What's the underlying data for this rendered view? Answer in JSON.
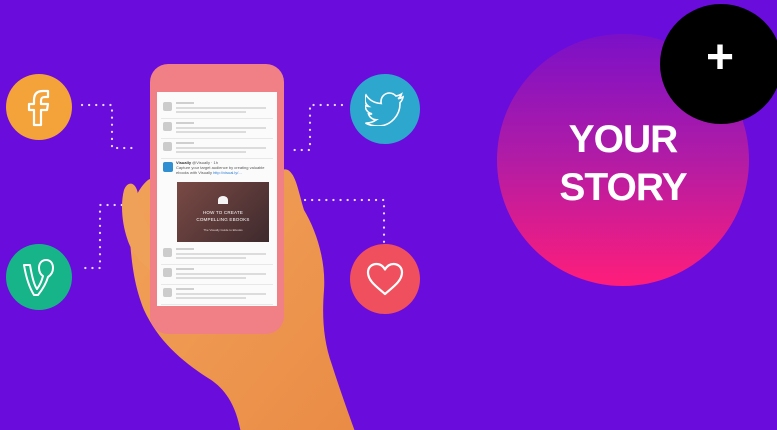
{
  "story": {
    "line1": "YOUR",
    "line2": "STORY"
  },
  "plus_label": "+",
  "icons": [
    "facebook-icon",
    "twitter-icon",
    "vine-icon",
    "heart-icon"
  ],
  "colors": {
    "background": "#6a0cdc",
    "facebook": "#f3a33a",
    "twitter": "#2ea7cf",
    "vine": "#16b488",
    "heart": "#f0505d",
    "phone": "#f07f86",
    "story_gradient_top": "#7b10c8",
    "story_gradient_bottom": "#ff1d7a"
  },
  "phone": {
    "featured_tweet": {
      "user": "Visually",
      "handle": "@Visually · 1h",
      "text": "Capture your target audience by creating valuable ebooks with Visually",
      "link": "http://visual.ly/...",
      "image_title_1": "HOW TO CREATE",
      "image_title_2": "COMPELLING EBOOKS",
      "image_caption": "The Visually Guide to Ebooks"
    }
  }
}
